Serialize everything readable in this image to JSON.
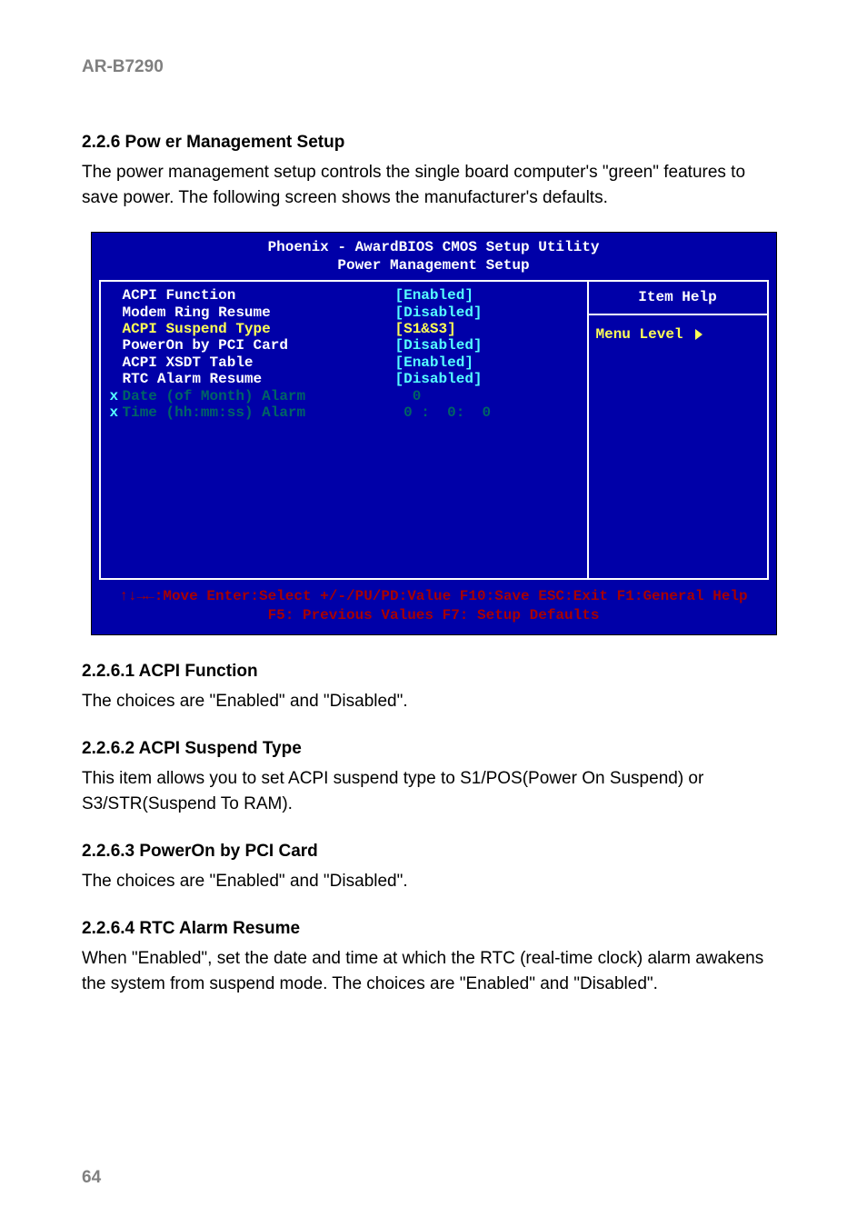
{
  "header": "AR-B7290",
  "page_number": "64",
  "section": {
    "heading": "2.2.6 Pow     er Management Setup",
    "intro": "The power management setup controls the single board computer's \"green\" features to save power. The following screen shows the manufacturer's defaults."
  },
  "bios": {
    "title1": "Phoenix - AwardBIOS CMOS Setup Utility",
    "title2": "Power Management Setup",
    "help_title": "Item Help",
    "menu_level": "Menu Level",
    "rows": [
      {
        "label": "ACPI Function",
        "value": "[Enabled]",
        "hl": true,
        "sub": false
      },
      {
        "label": "Modem Ring Resume",
        "value": "[Disabled]",
        "hl": false,
        "sub": false
      },
      {
        "label": "ACPI Suspend Type",
        "value": "[S1&S3]",
        "hl": false,
        "sub": false,
        "yel": true
      },
      {
        "label": "PowerOn by PCI Card",
        "value": "[Disabled]",
        "hl": false,
        "sub": false
      },
      {
        "label": "ACPI XSDT Table",
        "value": "[Enabled]",
        "hl": false,
        "sub": false
      },
      {
        "label": "RTC Alarm Resume",
        "value": "[Disabled]",
        "hl": false,
        "sub": false
      },
      {
        "label": "Date (of Month) Alarm",
        "value": "  0",
        "hl": false,
        "sub": true
      },
      {
        "label": "Time (hh:mm:ss) Alarm",
        "value": " 0 :  0:  0",
        "hl": false,
        "sub": true
      }
    ],
    "footer1": "↑↓→←:Move  Enter:Select  +/-/PU/PD:Value  F10:Save  ESC:Exit  F1:General Help",
    "footer2": "F5: Previous Values       F7: Setup Defaults"
  },
  "subs": [
    {
      "h": "2.2.6.1 ACPI   Function",
      "p": "The choices are \"Enabled\" and \"Disabled\"."
    },
    {
      "h": "2.2.6.2   ACPI Suspend Type",
      "p": "This item allows you to set ACPI suspend type to S1/POS(Power On Suspend) or S3/STR(Suspend To RAM)."
    },
    {
      "h": "2.2.6.3   PowerOn by PCI Card",
      "p": "The choices are \"Enabled\" and \"Disabled\"."
    },
    {
      "h": "2.2.6.4   RTC Alarm Resume",
      "p": "When \"Enabled\", set the date and time at which the RTC (real-time clock) alarm awakens the system from suspend mode. The choices are \"Enabled\" and \"Disabled\"."
    }
  ]
}
